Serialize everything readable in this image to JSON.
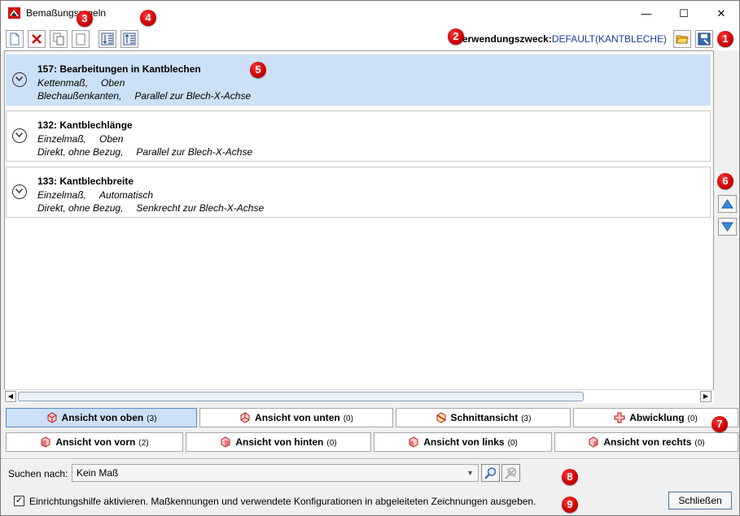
{
  "window": {
    "title": "Bemaßungsregeln",
    "minimize": "—",
    "maximize": "☐",
    "close": "✕"
  },
  "toolbar": {
    "purpose_label": "Verwendungszweck:",
    "purpose_value": "DEFAULT(KANTBLECHE)"
  },
  "rules": [
    {
      "title": "157: Bearbeitungen in Kantblechen",
      "line1a": "Kettenmaß,",
      "line1b": "Oben",
      "line2a": "Blechaußenkanten,",
      "line2b": "Parallel zur Blech-X-Achse",
      "selected": true
    },
    {
      "title": "132: Kantblechlänge",
      "line1a": "Einzelmaß,",
      "line1b": "Oben",
      "line2a": "Direkt, ohne Bezug,",
      "line2b": "Parallel zur Blech-X-Achse",
      "selected": false
    },
    {
      "title": "133: Kantblechbreite",
      "line1a": "Einzelmaß,",
      "line1b": "Automatisch",
      "line2a": "Direkt, ohne Bezug,",
      "line2b": "Senkrecht zur Blech-X-Achse",
      "selected": false
    }
  ],
  "views": [
    {
      "label": "Ansicht von oben",
      "count": "(3)",
      "active": true
    },
    {
      "label": "Ansicht von unten",
      "count": "(0)",
      "active": false
    },
    {
      "label": "Schnittansicht",
      "count": "(3)",
      "active": false
    },
    {
      "label": "Abwicklung",
      "count": "(0)",
      "active": false
    },
    {
      "label": "Ansicht von vorn",
      "count": "(2)",
      "active": false
    },
    {
      "label": "Ansicht von hinten",
      "count": "(0)",
      "active": false
    },
    {
      "label": "Ansicht von links",
      "count": "(0)",
      "active": false
    },
    {
      "label": "Ansicht von rechts",
      "count": "(0)",
      "active": false
    }
  ],
  "search": {
    "label": "Suchen nach:",
    "value": "Kein Maß"
  },
  "setup_help": {
    "checked": true,
    "label": "Einrichtungshilfe aktivieren. Maßkennungen und verwendete Konfigurationen in abgeleiteten Zeichnungen ausgeben."
  },
  "close_button": "Schließen",
  "badges": [
    "1",
    "2",
    "3",
    "4",
    "5",
    "6",
    "7",
    "8",
    "9"
  ],
  "colors": {
    "selection": "#cce0f7",
    "accent_border": "#5a8ac6",
    "badge": "#c80000",
    "purpose_value": "#1a3c9a"
  }
}
